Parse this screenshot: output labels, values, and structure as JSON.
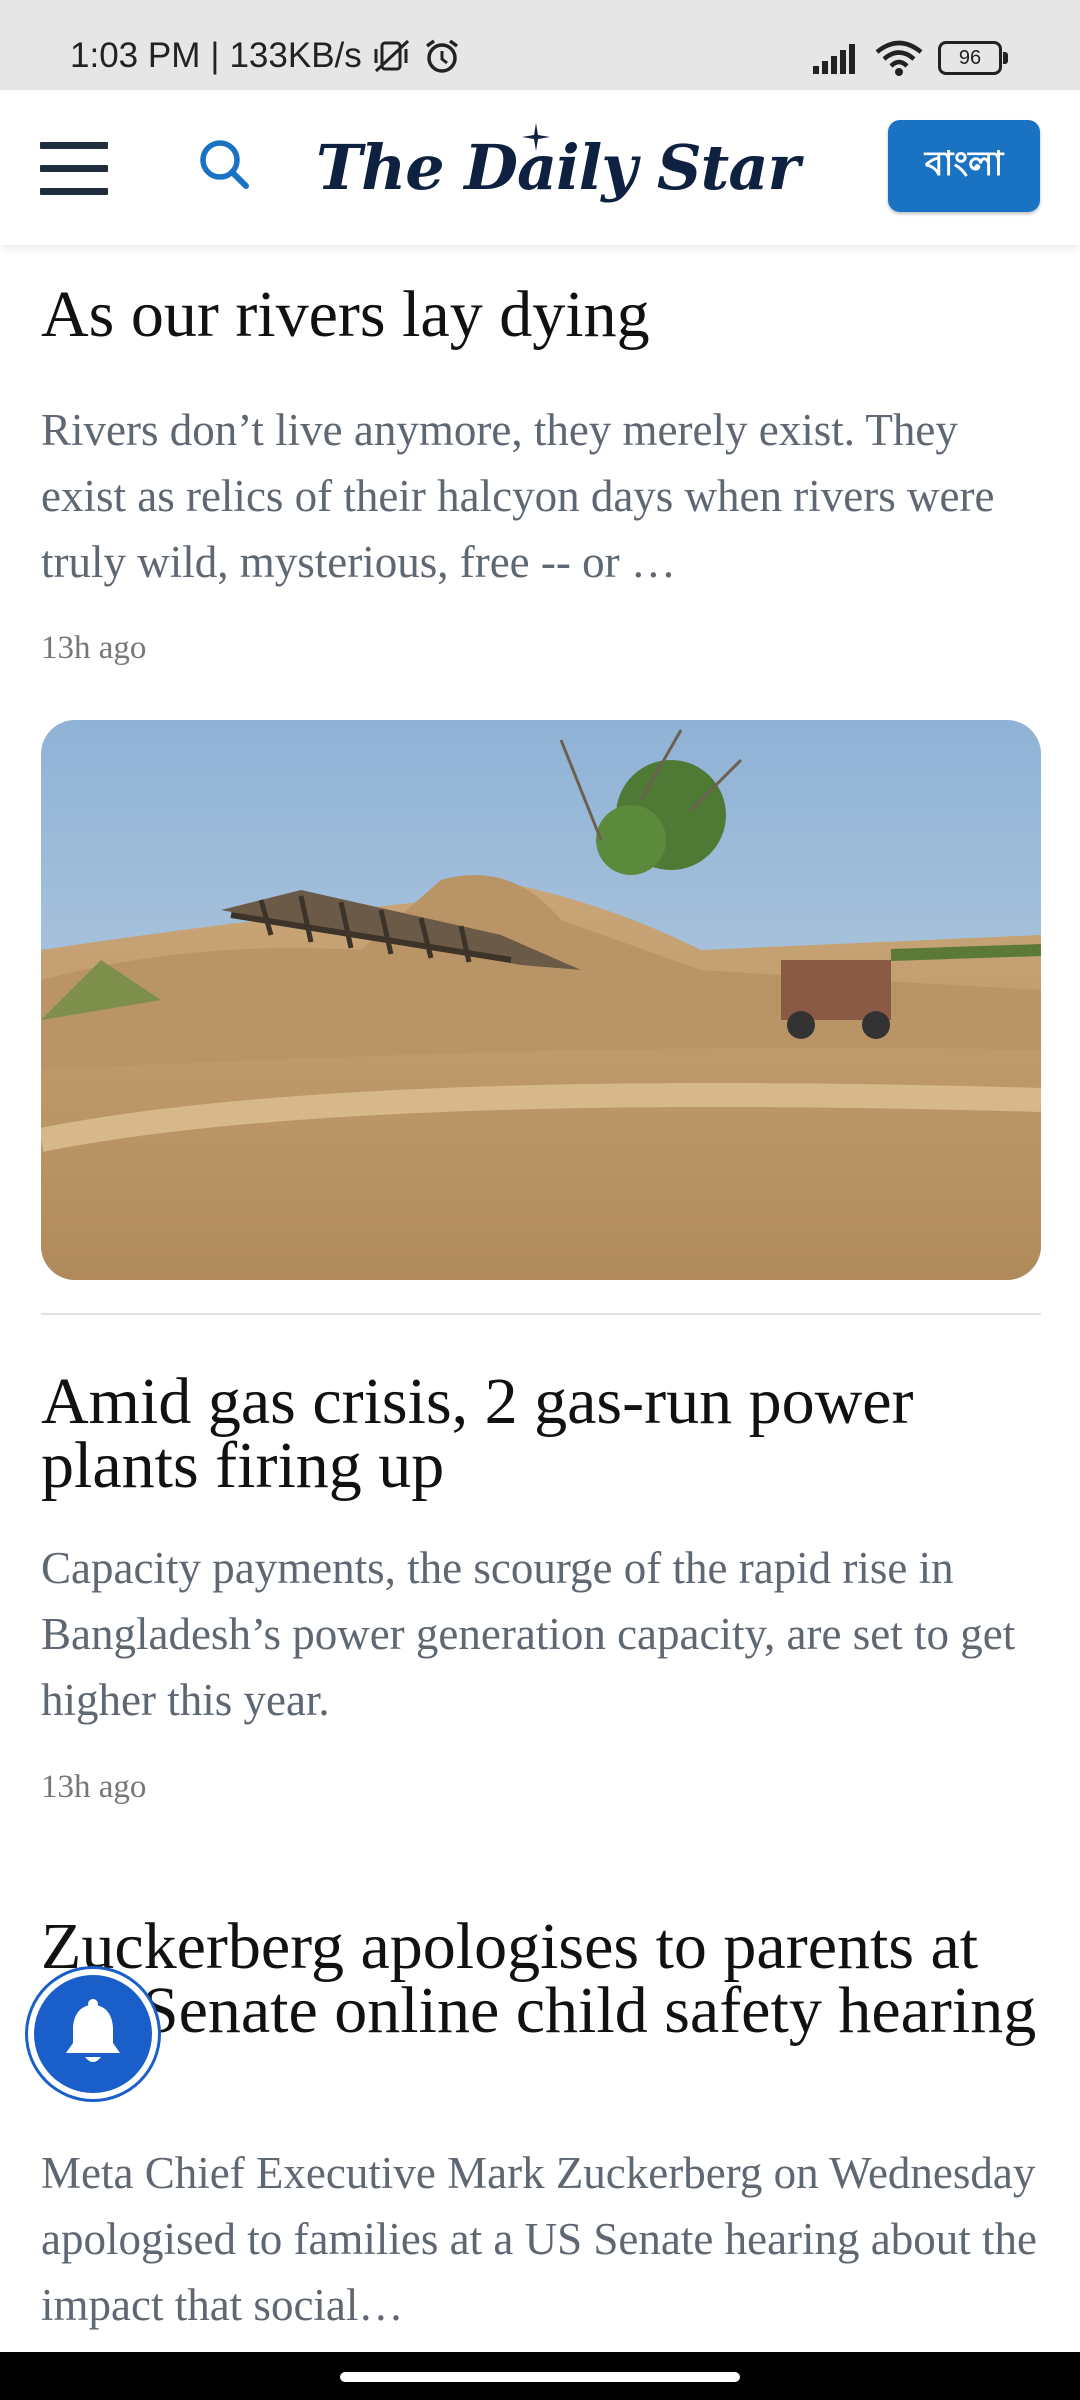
{
  "status_bar": {
    "time": "1:03 PM",
    "separator": "|",
    "network_speed": "133KB/s",
    "battery": "96",
    "icons": [
      "mute-vibrate-icon",
      "alarm-icon",
      "signal-icon",
      "wifi-icon",
      "battery-icon"
    ]
  },
  "header": {
    "logo_text": "The Daily Star",
    "bangla_button": "বাংলা",
    "icons": [
      "menu-icon",
      "search-icon"
    ],
    "accent_color": "#1a72c2"
  },
  "articles": [
    {
      "headline": "As our rivers lay dying",
      "summary": "Rivers don’t live anymore, they merely exist. They exist as relics of their halcyon days when rivers were truly wild, mysterious, free -- or …",
      "time": "13h ago"
    },
    {
      "headline": "Amid gas crisis, 2 gas-run power plants firing up",
      "summary": "Capacity payments, the scourge of the rapid rise in Bangladesh’s power generation capacity, are set to get higher this year.",
      "time": "13h ago"
    },
    {
      "headline": "Zuckerberg apologises to parents at US Senate online child safety hearing",
      "summary": "Meta Chief Executive Mark Zuckerberg on Wednesday apologised to families at a US Senate hearing about the impact that social…"
    }
  ],
  "floating": {
    "icon": "bell-icon"
  }
}
